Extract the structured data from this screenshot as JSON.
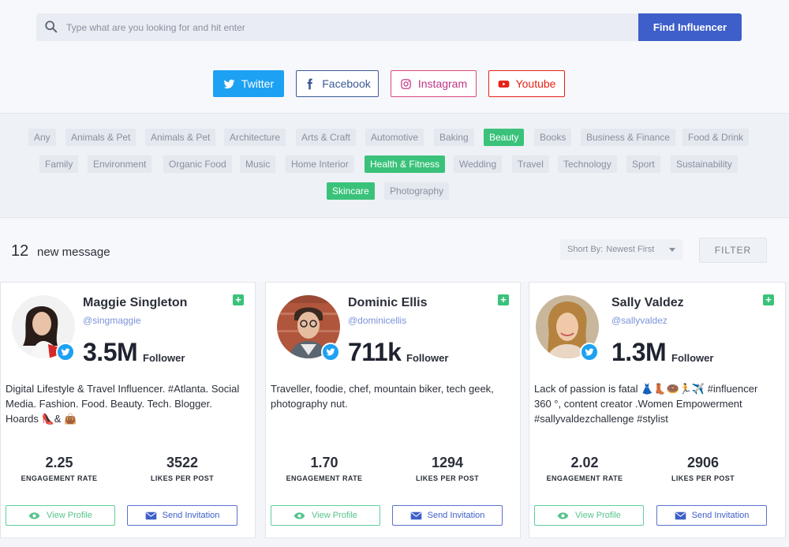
{
  "search": {
    "placeholder": "Type what are you looking for and hit enter",
    "button_label": "Find Influencer"
  },
  "platforms": [
    {
      "label": "Twitter",
      "icon": "twitter-icon",
      "selected": true
    },
    {
      "label": "Facebook",
      "icon": "facebook-icon",
      "selected": false
    },
    {
      "label": "Instagram",
      "icon": "instagram-icon",
      "selected": false
    },
    {
      "label": "Youtube",
      "icon": "youtube-icon",
      "selected": false
    }
  ],
  "categories": [
    {
      "label": "Any",
      "active": false
    },
    {
      "label": "Animals & Pet",
      "active": false
    },
    {
      "label": "Animals & Pet",
      "active": false
    },
    {
      "label": "Architecture",
      "active": false
    },
    {
      "label": "Arts & Craft",
      "active": false
    },
    {
      "label": "Automotive",
      "active": false
    },
    {
      "label": "Baking",
      "active": false
    },
    {
      "label": "Beauty",
      "active": true
    },
    {
      "label": "Books",
      "active": false
    },
    {
      "label": "Business & Finance",
      "active": false
    },
    {
      "label": "Food & Drink",
      "active": false
    },
    {
      "label": "Family",
      "active": false
    },
    {
      "label": "Environment",
      "active": false
    },
    {
      "label": "Organic Food",
      "active": false
    },
    {
      "label": "Music",
      "active": false
    },
    {
      "label": "Home Interior",
      "active": false
    },
    {
      "label": "Health & Fitness",
      "active": true
    },
    {
      "label": "Wedding",
      "active": false
    },
    {
      "label": "Travel",
      "active": false
    },
    {
      "label": "Technology",
      "active": false
    },
    {
      "label": "Sport",
      "active": false
    },
    {
      "label": "Sustainability",
      "active": false
    },
    {
      "label": "Skincare",
      "active": true
    },
    {
      "label": "Photography",
      "active": false
    }
  ],
  "header": {
    "count": "12",
    "count_label": "new message",
    "sort_label": "Short By:",
    "sort_value": "Newest First",
    "filter_label": "FILTER"
  },
  "cards": [
    {
      "name": "Maggie Singleton",
      "handle": "@singmaggie",
      "followers": "3.5M",
      "followers_label": "Follower",
      "bio": "Digital Lifestyle & Travel Influencer. #Atlanta. Social Media. Fashion. Food. Beauty. Tech. Blogger. Hoards 👠& 👜",
      "engagement": "2.25",
      "engagement_label": "ENGAGEMENT RATE",
      "likes": "3522",
      "likes_label": "LIKES PER POST",
      "view_label": "View Profile",
      "send_label": "Send Invitation"
    },
    {
      "name": "Dominic Ellis",
      "handle": "@dominicellis",
      "followers": "711k",
      "followers_label": "Follower",
      "bio": "Traveller, foodie, chef, mountain biker, tech geek, photography nut.",
      "engagement": "1.70",
      "engagement_label": "ENGAGEMENT RATE",
      "likes": "1294",
      "likes_label": "LIKES PER POST",
      "view_label": "View Profile",
      "send_label": "Send Invitation"
    },
    {
      "name": "Sally Valdez",
      "handle": "@sallyvaldez",
      "followers": "1.3M",
      "followers_label": "Follower",
      "bio": "Lack of passion is fatal 👗👢🍩🏃✈️ #influencer 360 °, content creator .Women Empowerment #sallyvaldezchallenge #stylist",
      "engagement": "2.02",
      "engagement_label": "ENGAGEMENT RATE",
      "likes": "2906",
      "likes_label": "LIKES PER POST",
      "view_label": "View Profile",
      "send_label": "Send Invitation"
    }
  ],
  "colors": {
    "primary": "#3e5ec9",
    "twitter": "#1da1f2",
    "green": "#3ac27a",
    "youtube": "#e62117",
    "instagram": "#c13584",
    "facebook": "#3b5998"
  }
}
